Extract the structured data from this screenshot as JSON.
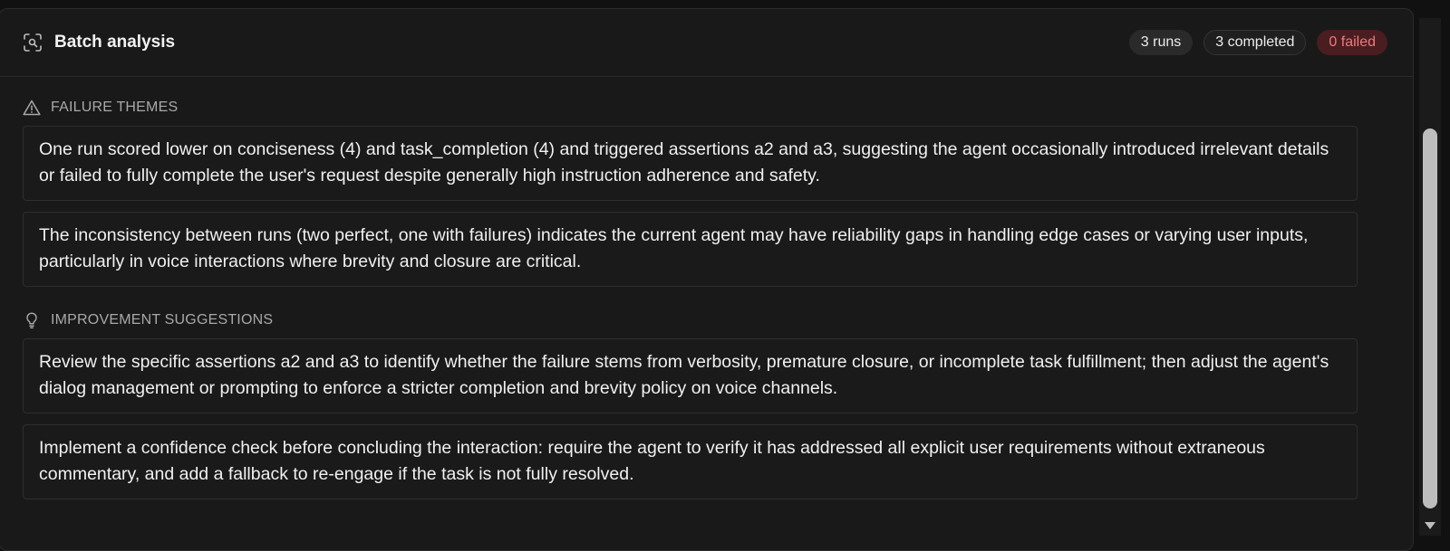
{
  "header": {
    "title": "Batch analysis",
    "badges": {
      "runs": "3 runs",
      "completed": "3 completed",
      "failed": "0 failed"
    }
  },
  "failure_themes": {
    "title": "FAILURE THEMES",
    "items": [
      "One run scored lower on conciseness (4) and task_completion (4) and triggered assertions a2 and a3, suggesting the agent occasionally introduced irrelevant details or failed to fully complete the user's request despite generally high instruction adherence and safety.",
      "The inconsistency between runs (two perfect, one with failures) indicates the current agent may have reliability gaps in handling edge cases or varying user inputs, particularly in voice interactions where brevity and closure are critical."
    ]
  },
  "improvement_suggestions": {
    "title": "IMPROVEMENT SUGGESTIONS",
    "items": [
      "Review the specific assertions a2 and a3 to identify whether the failure stems from verbosity, premature closure, or incomplete task fulfillment; then adjust the agent's dialog management or prompting to enforce a stricter completion and brevity policy on voice channels.",
      "Implement a confidence check before concluding the interaction: require the agent to verify it has addressed all explicit user requirements without extraneous commentary, and add a fallback to re-engage if the task is not fully resolved."
    ]
  },
  "colors": {
    "accent_failed_bg": "#4a1d21",
    "accent_failed_text": "#f07a7d",
    "panel_bg": "#191919"
  }
}
